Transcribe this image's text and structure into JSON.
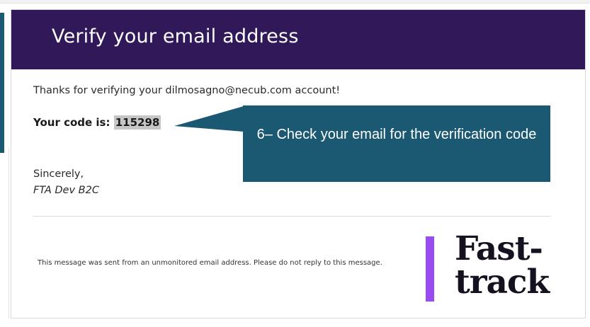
{
  "email": {
    "header_title": "Verify your email address",
    "thanks_text": "Thanks for verifying your dilmosagno@necub.com account!",
    "code_label": "Your code is:",
    "code_value": "115298",
    "closing": "Sincerely,",
    "signature": "FTA Dev B2C",
    "footer_note": "This message was sent from an unmonitored email address. Please do not reply to this message."
  },
  "logo": {
    "line1": "Fast-",
    "line2": "track",
    "bar_color": "#9a4cf0"
  },
  "callout": {
    "text": "6– Check your email for the verification code",
    "color": "#1b5872"
  },
  "colors": {
    "header_bg": "#301859",
    "accent_teal": "#1b5872",
    "code_highlight": "#c6c6c6"
  }
}
